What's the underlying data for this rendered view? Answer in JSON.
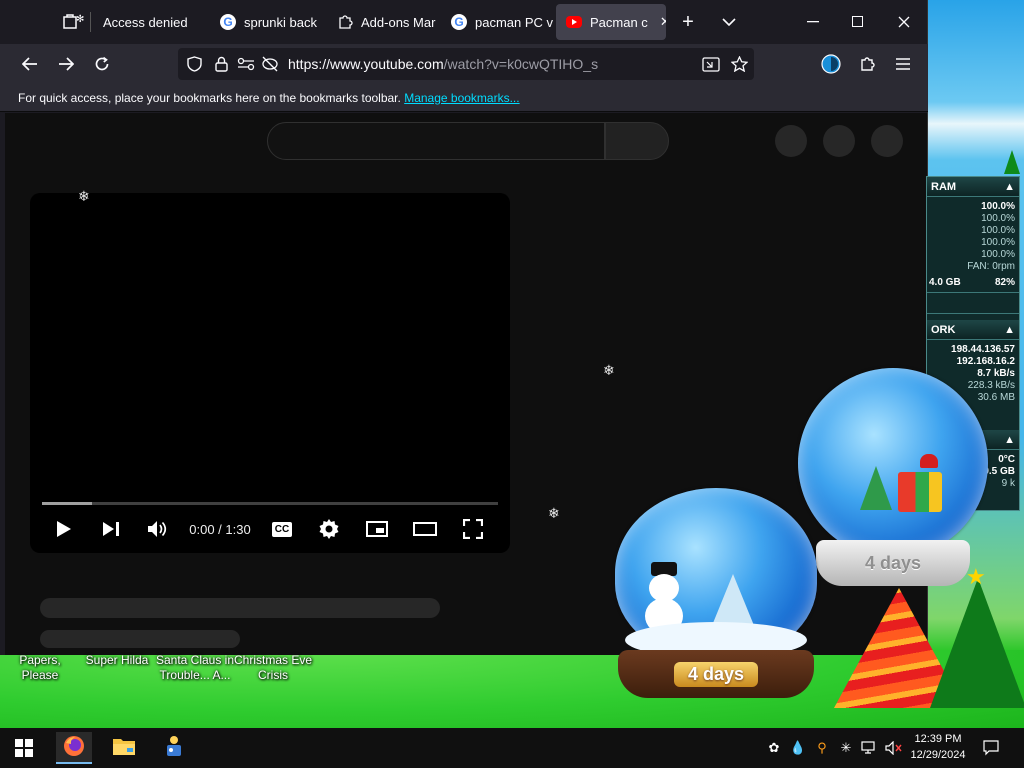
{
  "tabs": [
    {
      "label": "Access denied",
      "icon": "shield-lock-icon"
    },
    {
      "label": "sprunki back",
      "icon": "google-icon"
    },
    {
      "label": "Add-ons Mar",
      "icon": "puzzle-icon"
    },
    {
      "label": "pacman PC v",
      "icon": "google-icon"
    },
    {
      "label": "Pacman c",
      "icon": "youtube-icon",
      "active": true
    }
  ],
  "nav": {
    "url_host": "https://www.youtube.com",
    "url_path": "/watch?v=k0cwQTIHO_s"
  },
  "bookmarks_bar": {
    "text": "For quick access, place your bookmarks here on the bookmarks toolbar.",
    "link": "Manage bookmarks..."
  },
  "player": {
    "time": "0:00 / 1:30",
    "cc_label": "CC",
    "progress_fraction": 0.11
  },
  "desktop_icons": [
    {
      "label": "Papers, Please"
    },
    {
      "label": "Super Hilda"
    },
    {
      "label": "Santa Claus in Trouble... A..."
    },
    {
      "label": "Christmas Eve Crisis"
    }
  ],
  "widget": {
    "ram_header": "RAM",
    "cpu_total": "100.0%",
    "cpu_cores": [
      "100.0%",
      "100.0%",
      "100.0%",
      "100.0%"
    ],
    "fan": "FAN: 0rpm",
    "mem_used": "4.0 GB",
    "mem_pct": "82%",
    "network_header": "ORK",
    "ip_public": "198.44.136.57",
    "ip_local": "192.168.16.2",
    "up_rate": "8.7 kB/s",
    "down_rate": "228.3 kB/s",
    "total": "30.6 MB",
    "temp": "0°C",
    "disk": "9.5 GB",
    "disk_rate": "9 k"
  },
  "globes": {
    "small_days": "4 days",
    "large_days": "4 days"
  },
  "taskbar": {
    "time": "12:39 PM",
    "date": "12/29/2024"
  }
}
